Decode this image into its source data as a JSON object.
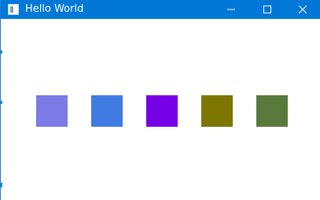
{
  "window": {
    "title": "Hello World",
    "titlebar_color": "#0078d7",
    "controls": {
      "minimize_icon": "minimize-icon",
      "maximize_icon": "maximize-icon",
      "close_icon": "close-icon"
    }
  },
  "content": {
    "background": "#ffffff",
    "squares": [
      {
        "name": "square-1",
        "color": "#7b7ae6"
      },
      {
        "name": "square-2",
        "color": "#3f7be3"
      },
      {
        "name": "square-3",
        "color": "#7600e8"
      },
      {
        "name": "square-4",
        "color": "#7d7600"
      },
      {
        "name": "square-5",
        "color": "#5a7a3d"
      }
    ]
  }
}
